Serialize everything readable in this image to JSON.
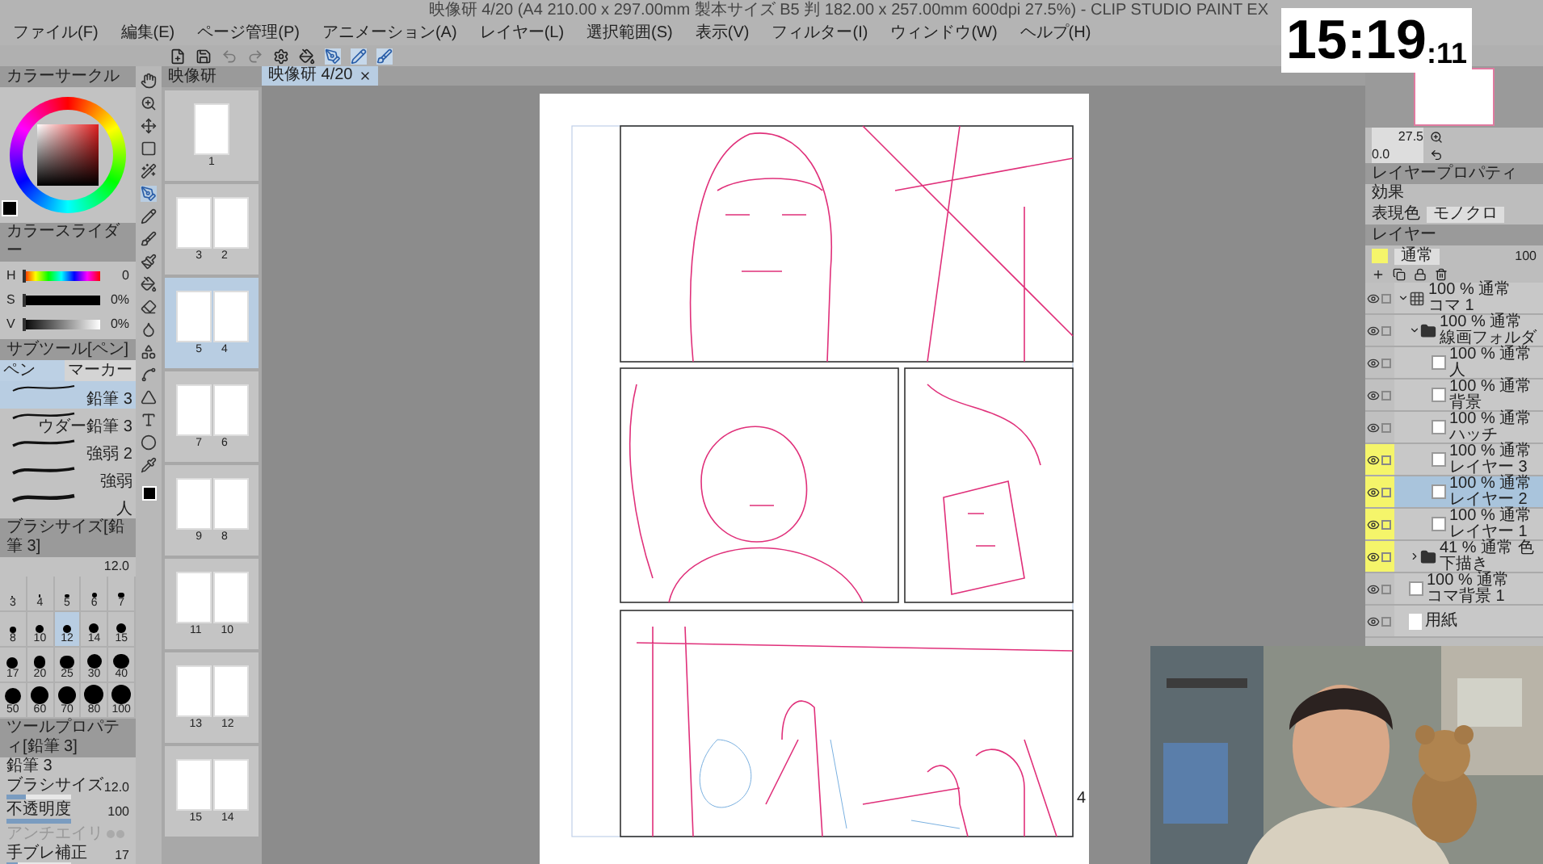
{
  "title": "映像研 4/20 (A4 210.00 x 297.00mm 製本サイズ B5 判 182.00 x 257.00mm 600dpi 27.5%) - CLIP STUDIO PAINT EX",
  "menu": [
    "ファイル(F)",
    "編集(E)",
    "ページ管理(P)",
    "アニメーション(A)",
    "レイヤー(L)",
    "選択範囲(S)",
    "表示(V)",
    "フィルター(I)",
    "ウィンドウ(W)",
    "ヘルプ(H)"
  ],
  "color_circle": {
    "title": "カラーサークル"
  },
  "color_slider": {
    "title": "カラースライダー",
    "rows": [
      {
        "label": "H",
        "value": "0",
        "level": 0
      },
      {
        "label": "S",
        "value": "0%",
        "level": 0
      },
      {
        "label": "V",
        "value": "0%",
        "level": 0
      }
    ]
  },
  "sub_tool": {
    "title": "サブツール[ペン]",
    "tabs": [
      {
        "label": "ペン",
        "selected": true
      },
      {
        "label": "マーカー",
        "selected": false
      }
    ],
    "brushes": [
      {
        "name": "鉛筆 3",
        "selected": true
      },
      {
        "name": "ウダー鉛筆 3",
        "selected": false
      },
      {
        "name": "強弱 2",
        "selected": false
      },
      {
        "name": "強弱",
        "selected": false
      },
      {
        "name": "人",
        "selected": false
      }
    ]
  },
  "brush_size": {
    "title": "ブラシサイズ[鉛筆 3]",
    "value": "12.0",
    "sizes": [
      {
        "label": "3",
        "selected": false
      },
      {
        "label": "4",
        "selected": false
      },
      {
        "label": "5",
        "selected": false
      },
      {
        "label": "6",
        "selected": false
      },
      {
        "label": "7",
        "selected": false
      },
      {
        "label": "8",
        "selected": false
      },
      {
        "label": "10",
        "selected": false
      },
      {
        "label": "12",
        "selected": true
      },
      {
        "label": "14",
        "selected": false
      },
      {
        "label": "15",
        "selected": false
      },
      {
        "label": "17",
        "selected": false
      },
      {
        "label": "20",
        "selected": false
      },
      {
        "label": "25",
        "selected": false
      },
      {
        "label": "30",
        "selected": false
      },
      {
        "label": "40",
        "selected": false
      },
      {
        "label": "50",
        "selected": false
      },
      {
        "label": "60",
        "selected": false
      },
      {
        "label": "70",
        "selected": false
      },
      {
        "label": "80",
        "selected": false
      },
      {
        "label": "100",
        "selected": false
      }
    ]
  },
  "tool_property": {
    "title": "ツールプロパティ[鉛筆 3]",
    "brush": "鉛筆 3",
    "rows": [
      {
        "kind": "slider",
        "label": "ブラシサイズ",
        "value": "12.0",
        "level": 0.3
      },
      {
        "kind": "slider",
        "label": "不透明度",
        "value": "100",
        "level": 1
      },
      {
        "kind": "dots",
        "label": "アンチエイリ"
      },
      {
        "kind": "slider",
        "label": "手ブレ補正",
        "value": "17",
        "level": 0.17
      }
    ]
  },
  "pages": {
    "title": "映像研",
    "spreads": [
      {
        "pages": [
          "1"
        ],
        "selected": false
      },
      {
        "pages": [
          "3",
          "2"
        ],
        "selected": false
      },
      {
        "pages": [
          "5",
          "4"
        ],
        "selected": true
      },
      {
        "pages": [
          "7",
          "6"
        ],
        "selected": false
      },
      {
        "pages": [
          "9",
          "8"
        ],
        "selected": false
      },
      {
        "pages": [
          "11",
          "10"
        ],
        "selected": false
      },
      {
        "pages": [
          "13",
          "12"
        ],
        "selected": false
      },
      {
        "pages": [
          "15",
          "14"
        ],
        "selected": false
      }
    ]
  },
  "canvas_tab": {
    "label": "映像研 4/20"
  },
  "page_number": "4",
  "navigator": {
    "zoom": "27.5",
    "angle": "0.0"
  },
  "layer_property": {
    "title": "レイヤープロパティ",
    "effect_label": "効果",
    "color_label": "表現色",
    "color_mode": "モノクロ"
  },
  "layers": {
    "title": "レイヤー",
    "blend": "通常",
    "opacity": "100",
    "items": [
      {
        "kind": "frame",
        "info": "100 % 通常",
        "name": "コマ 1",
        "visible": true,
        "marked": false,
        "selected": false,
        "expanded": true,
        "children": [
          {
            "kind": "folder",
            "info": "100 % 通常",
            "name": "線画フォルダ",
            "visible": true,
            "marked": false,
            "selected": false,
            "expanded": true,
            "children": [
              {
                "kind": "raster",
                "info": "100 % 通常",
                "name": "人",
                "visible": true,
                "marked": false,
                "selected": false
              },
              {
                "kind": "raster",
                "info": "100 % 通常",
                "name": "背景",
                "visible": true,
                "marked": false,
                "selected": false
              },
              {
                "kind": "raster",
                "info": "100 % 通常",
                "name": "ハッチ",
                "visible": true,
                "marked": false,
                "selected": false
              },
              {
                "kind": "raster",
                "info": "100 % 通常",
                "name": "レイヤー 3",
                "visible": true,
                "marked": true,
                "selected": false
              },
              {
                "kind": "raster",
                "info": "100 % 通常",
                "name": "レイヤー 2",
                "visible": true,
                "marked": true,
                "selected": true
              },
              {
                "kind": "raster",
                "info": "100 % 通常",
                "name": "レイヤー 1",
                "visible": true,
                "marked": true,
                "selected": false
              }
            ]
          },
          {
            "kind": "folder",
            "info": "41 % 通常 色",
            "name": "下描き",
            "visible": true,
            "marked": true,
            "selected": false,
            "expanded": false
          }
        ]
      },
      {
        "kind": "raster",
        "info": "100 % 通常",
        "name": "コマ背景 1",
        "visible": true,
        "marked": false,
        "selected": false
      },
      {
        "kind": "paper",
        "name": "用紙",
        "visible": true,
        "marked": false,
        "selected": false
      }
    ]
  },
  "clock": {
    "time": "15:19",
    "seconds": ":11"
  }
}
